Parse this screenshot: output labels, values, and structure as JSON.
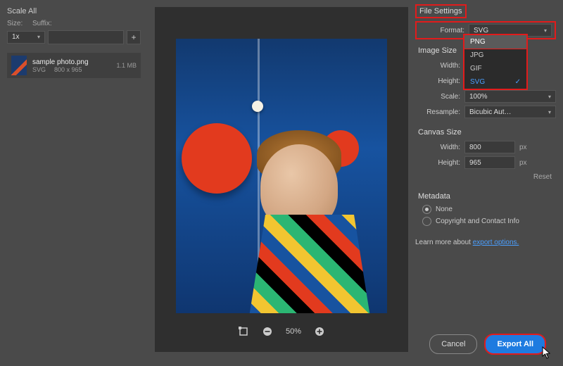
{
  "left": {
    "header": "Scale All",
    "size_label": "Size:",
    "suffix_label": "Suffix:",
    "scale_value": "1x",
    "add_label": "+",
    "asset": {
      "name": "sample photo.png",
      "format": "SVG",
      "dims": "800 x 965",
      "filesize": "1.1 MB"
    }
  },
  "preview": {
    "zoom_value": "50%"
  },
  "settings": {
    "file_settings_title": "File Settings",
    "format_label": "Format:",
    "format_value": "SVG",
    "dropdown": {
      "opt_png": "PNG",
      "opt_jpg": "JPG",
      "opt_gif": "GIF",
      "opt_svg": "SVG"
    },
    "image_size_title": "Image Size",
    "width_label": "Width:",
    "height_label": "Height:",
    "scale_label": "Scale:",
    "scale_value": "100%",
    "resample_label": "Resample:",
    "resample_value": "Bicubic Aut…",
    "unit_px": "px",
    "canvas_size_title": "Canvas Size",
    "canvas_width": "800",
    "canvas_height": "965",
    "reset_label": "Reset",
    "metadata_title": "Metadata",
    "metadata_none": "None",
    "metadata_copyright": "Copyright and Contact Info",
    "learn_more_prefix": "Learn more about ",
    "learn_more_link": "export options."
  },
  "footer": {
    "cancel": "Cancel",
    "export": "Export All"
  }
}
